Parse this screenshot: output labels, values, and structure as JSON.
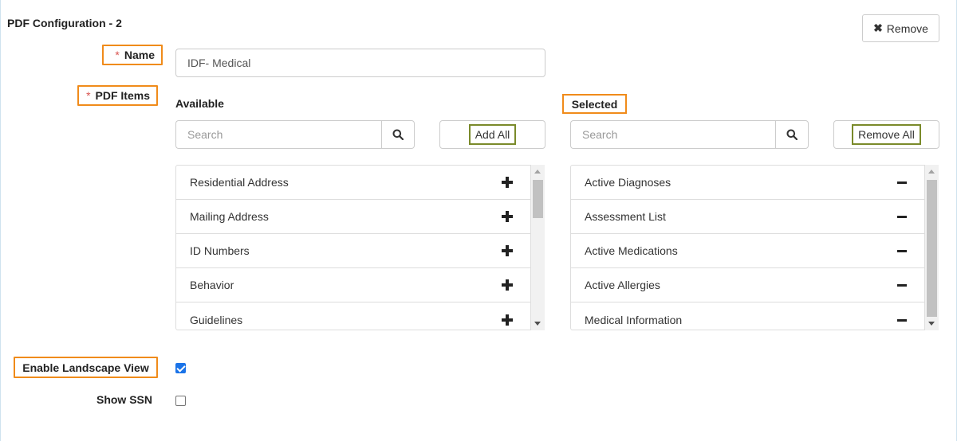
{
  "config": {
    "title": "PDF Configuration - 2",
    "remove_label": "Remove"
  },
  "name_field": {
    "label": "Name",
    "required_mark": "*",
    "value": "IDF- Medical"
  },
  "pdf_items": {
    "label": "PDF Items",
    "required_mark": "*",
    "available": {
      "heading": "Available",
      "search_placeholder": "Search",
      "add_all_label": "Add All",
      "items": [
        "Residential Address",
        "Mailing Address",
        "ID Numbers",
        "Behavior",
        "Guidelines"
      ]
    },
    "selected": {
      "heading": "Selected",
      "search_placeholder": "Search",
      "remove_all_label": "Remove All",
      "items": [
        "Active Diagnoses",
        "Assessment List",
        "Active Medications",
        "Active Allergies",
        "Medical Information"
      ]
    }
  },
  "options": {
    "landscape_label": "Enable Landscape View",
    "landscape_checked": true,
    "ssn_label": "Show SSN",
    "ssn_checked": false
  },
  "icons": {
    "search": "search-icon",
    "add": "plus-icon",
    "remove": "minus-icon",
    "close": "close-icon"
  },
  "colors": {
    "highlight": "#f08b1a",
    "button_highlight": "#7a8a2a",
    "checkbox": "#1a73e8"
  }
}
